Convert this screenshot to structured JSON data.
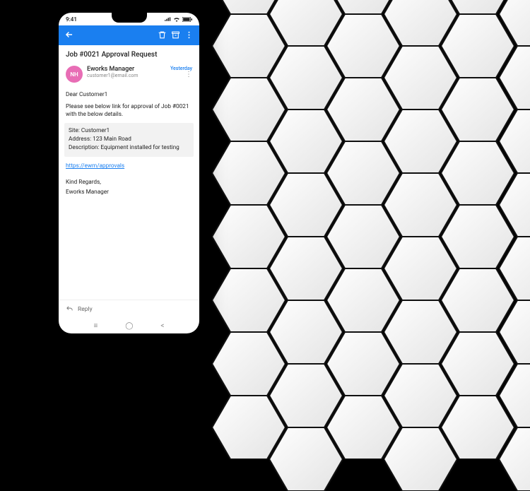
{
  "status": {
    "time": "9:41"
  },
  "email": {
    "subject": "Job #0021 Approval Request",
    "avatar_initials": "NH",
    "sender_name": "Eworks Manager",
    "sender_email": "customer1@email.com",
    "timestamp": "Yesterday",
    "greeting": "Dear Customer1",
    "intro": "Please see below link for approval of Job #0021 with the below details.",
    "details": {
      "site_label": "Site:",
      "site_value": "Customer1",
      "address_label": "Address:",
      "address_value": "123 Main Road",
      "desc_label": "Description:",
      "desc_value": "Equipment installed for testing"
    },
    "link_text": "https://ewm/approvals",
    "signoff1": "Kind Regards,",
    "signoff2": "Eworks Manager",
    "reply_label": "Reply"
  }
}
